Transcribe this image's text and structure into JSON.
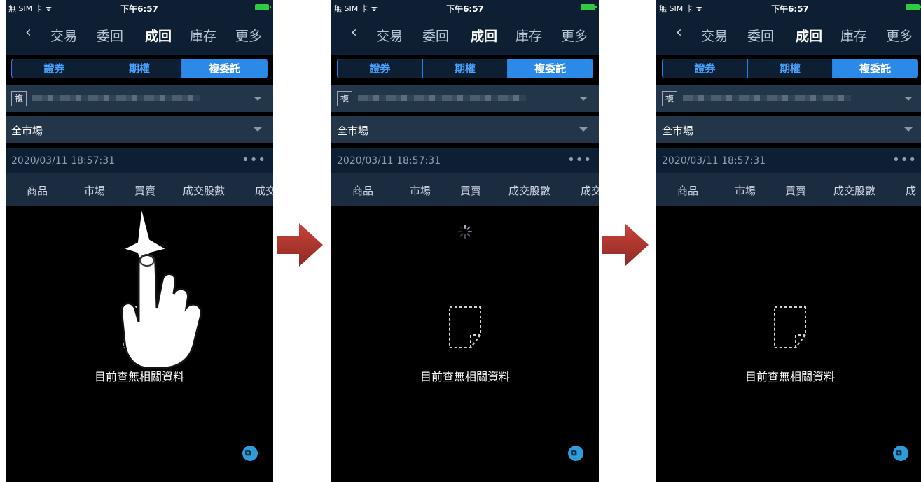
{
  "screens": [
    {
      "status": {
        "carrier": "無 SIM 卡 ᯤ",
        "time": "下午6:57"
      },
      "nav": {
        "back": "‹",
        "items": [
          "交易",
          "委回",
          "成回",
          "庫存",
          "更多"
        ],
        "active": "成回"
      },
      "segments": [
        "證券",
        "期權",
        "複委託"
      ],
      "account_badge": "複",
      "market": "全市場",
      "timestamp": "2020/03/11 18:57:31",
      "more": "•••",
      "columns": [
        "商品",
        "市場",
        "買賣",
        "成交股數",
        "成交"
      ],
      "empty_message": "目前查無相關資料",
      "overlay": "pull-down-gesture-hand"
    },
    {
      "status": {
        "carrier": "無 SIM 卡 ᯤ",
        "time": "下午6:57"
      },
      "nav": {
        "back": "‹",
        "items": [
          "交易",
          "委回",
          "成回",
          "庫存",
          "更多"
        ],
        "active": "成回"
      },
      "segments": [
        "證券",
        "期權",
        "複委託"
      ],
      "account_badge": "複",
      "market": "全市場",
      "timestamp": "2020/03/11 18:57:31",
      "more": "•••",
      "columns": [
        "商品",
        "市場",
        "買賣",
        "成交股數",
        "成交"
      ],
      "empty_message": "目前查無相關資料",
      "overlay": "loading-spinner"
    },
    {
      "status": {
        "carrier": "無 SIM 卡 ᯤ",
        "time": "下午6:57"
      },
      "nav": {
        "back": "‹",
        "items": [
          "交易",
          "委回",
          "成回",
          "庫存",
          "更多"
        ],
        "active": "成回"
      },
      "segments": [
        "證券",
        "期權",
        "複委託"
      ],
      "account_badge": "複",
      "market": "全市場",
      "timestamp": "2020/03/11 18:57:31",
      "more": "•••",
      "columns": [
        "商品",
        "市場",
        "買賣",
        "成交股數",
        "成"
      ],
      "empty_message": "目前查無相關資料",
      "overlay": "none"
    }
  ],
  "colors": {
    "header_bg": "#0f1f33",
    "row_bg": "#233548",
    "accent": "#2b8ae8",
    "transition_arrow": "#b3362f"
  },
  "icons": {
    "empty_state": "blank-document-icon",
    "fab": "chart-export-icon",
    "transition": "right-arrow-icon"
  }
}
